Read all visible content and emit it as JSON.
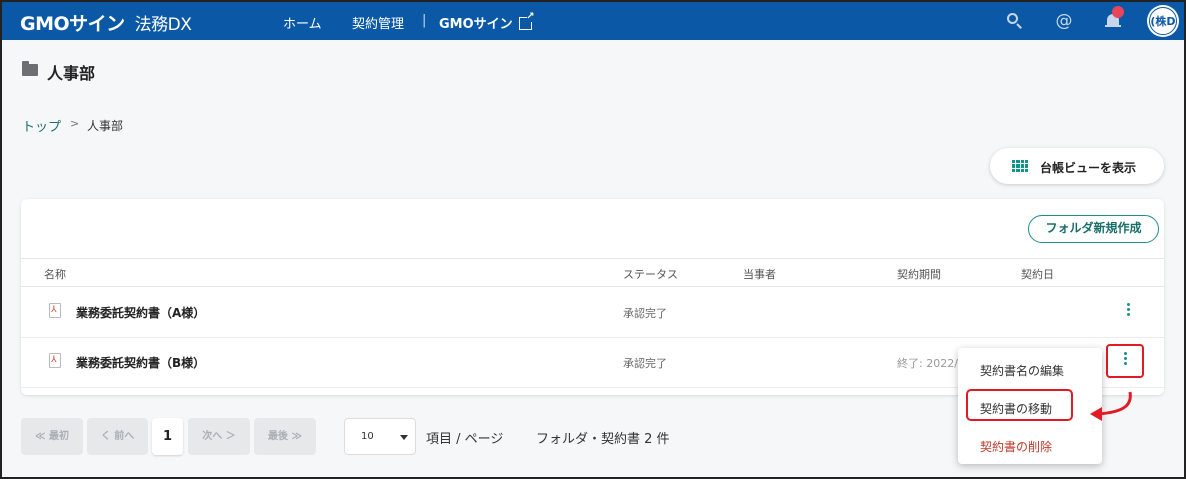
{
  "header": {
    "logo_brand": "GMOサイン",
    "logo_service": "法務DX",
    "nav_home": "ホーム",
    "nav_contract": "契約管理",
    "nav_separator": "|",
    "nav_gmo": "GMOサイン",
    "at_symbol": "@",
    "avatar_text": "(株D"
  },
  "page": {
    "title": "人事部",
    "breadcrumb_top": "トップ",
    "breadcrumb_sep": ">",
    "breadcrumb_current": "人事部",
    "ledger_button": "台帳ビューを表示",
    "new_folder_button": "フォルダ新規作成"
  },
  "table": {
    "columns": {
      "name": "名称",
      "status": "ステータス",
      "party": "当事者",
      "period": "契約期間",
      "date": "契約日"
    },
    "rows": [
      {
        "name": "業務委託契約書（A様）",
        "status": "承認完了",
        "period": ""
      },
      {
        "name": "業務委託契約書（B様）",
        "status": "承認完了",
        "period": "終了: 2022/"
      }
    ]
  },
  "pager": {
    "first": "≪ 最初",
    "prev": "く 前へ",
    "current": "1",
    "next": "次へ ＞",
    "last": "最後 ≫",
    "per_page_value": "10",
    "per_page_label": "項目 / ページ",
    "count_label": "フォルダ・契約書 2 件"
  },
  "menu": {
    "edit_name": "契約書名の編集",
    "move": "契約書の移動",
    "delete": "契約書の削除"
  },
  "colors": {
    "header_bg": "#0b59a6",
    "accent_teal": "#14938a",
    "highlight_red": "#e01b24",
    "delete_red": "#c0392b"
  }
}
